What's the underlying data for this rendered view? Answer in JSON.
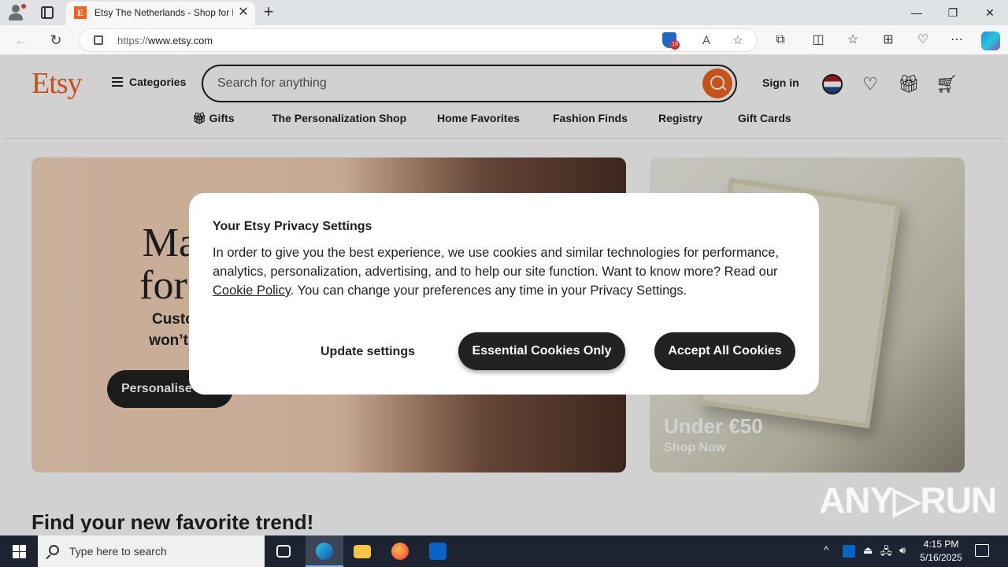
{
  "browser": {
    "tab_title": "Etsy The Netherlands - Shop for handmade, vintage, custom, and unique gifts",
    "url_prefix": "https://",
    "url_host": "www.etsy.com",
    "tracker_count": "19"
  },
  "site": {
    "logo": "Etsy",
    "categories_label": "Categories",
    "search_placeholder": "Search for anything",
    "signin_label": "Sign in",
    "nav": [
      "Gifts",
      "The Personalization Shop",
      "Home Favorites",
      "Fashion Finds",
      "Registry",
      "Gift Cards"
    ]
  },
  "hero": {
    "headline_line1": "Made",
    "headline_line2": "for yo",
    "sub_line1": "Custom piec",
    "sub_line2": "won’t find els",
    "cta": "Personalise it",
    "right_title": "Under €50",
    "right_link": "Shop Now"
  },
  "section_title": "Find your new favorite trend!",
  "privacy_modal": {
    "title": "Your Etsy Privacy Settings",
    "body_before_link": "In order to give you the best experience, we use cookies and similar technologies for performance, analytics, personalization, advertising, and to help our site function. Want to know more? Read our ",
    "link_text": "Cookie Policy",
    "body_after_link": ". You can change your preferences any time in your Privacy Settings.",
    "update_button": "Update settings",
    "essential_button": "Essential Cookies Only",
    "accept_button": "Accept All Cookies"
  },
  "watermark": "ANY▷RUN",
  "taskbar": {
    "search_placeholder": "Type here to search",
    "time": "4:15 PM",
    "date": "5/16/2025"
  },
  "colors": {
    "brand": "#f1641e",
    "dark_button": "#222222",
    "taskbar": "#1c2331"
  }
}
